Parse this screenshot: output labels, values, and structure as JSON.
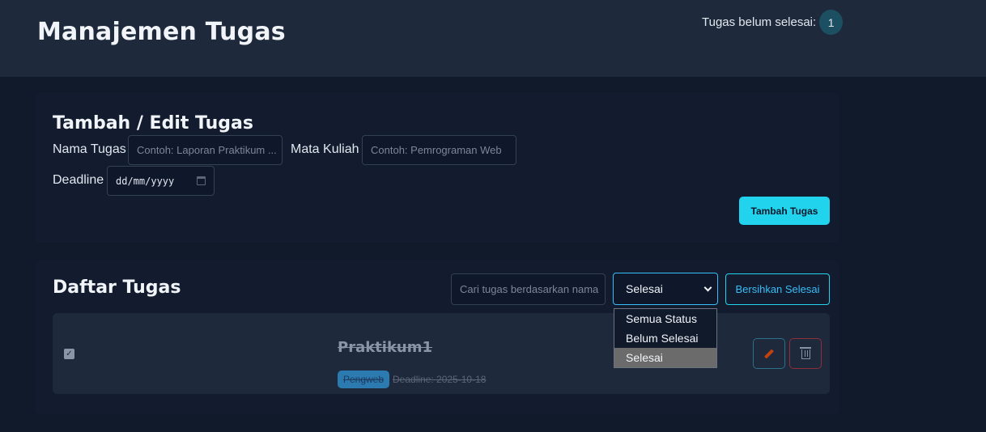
{
  "header": {
    "title": "Manajemen Tugas",
    "pending_label": "Tugas belum selesai:",
    "pending_count": "1"
  },
  "form": {
    "title": "Tambah / Edit Tugas",
    "task_name_label": "Nama Tugas",
    "task_name_placeholder": "Contoh: Laporan Praktikum ...",
    "course_label": "Mata Kuliah",
    "course_placeholder": "Contoh: Pemrograman Web",
    "deadline_label": "Deadline",
    "deadline_placeholder": "dd/mm/yyyy",
    "submit_label": "Tambah Tugas"
  },
  "list": {
    "title": "Daftar Tugas",
    "search_placeholder": "Cari tugas berdasarkan nama",
    "filter_value": "Selesai",
    "filter_options": [
      "Semua Status",
      "Belum Selesai",
      "Selesai"
    ],
    "filter_selected_index": 2,
    "clear_label": "Bersihkan Selesai"
  },
  "tasks": [
    {
      "name": "Praktikum1",
      "course": "Pengweb",
      "deadline": "Deadline: 2025-10-18",
      "completed": true
    }
  ],
  "colors": {
    "accent": "#22d3ee",
    "background": "#111a2b",
    "header_bg": "#1e293b",
    "danger": "#8c2f3a"
  }
}
